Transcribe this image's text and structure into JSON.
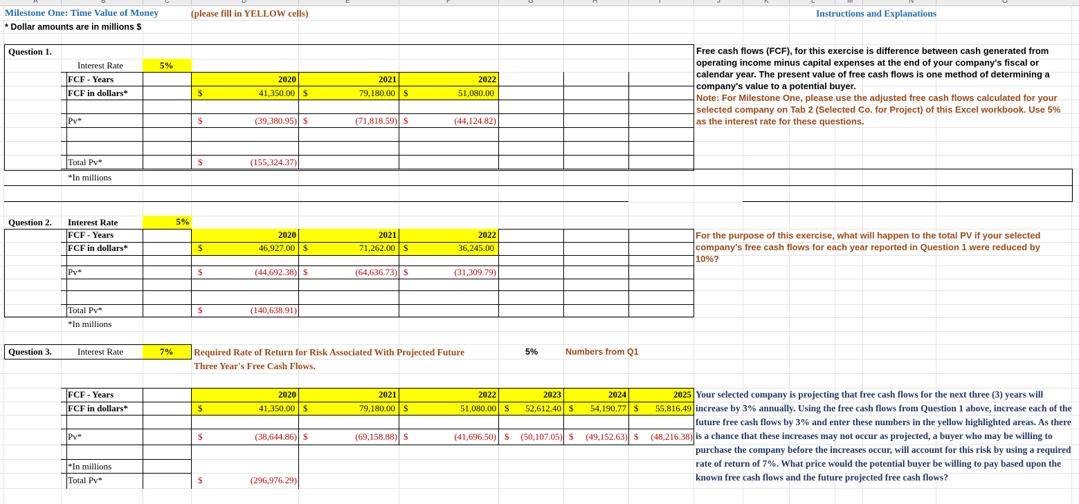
{
  "columns": [
    "A",
    "B",
    "C",
    "D",
    "E",
    "F",
    "G",
    "H",
    "I",
    "J",
    "K",
    "L",
    "M",
    "N",
    "O"
  ],
  "header": {
    "title": "Milestone One: Time Value of Money",
    "fill_note": "(please fill in YELLOW cells)",
    "dollar_note": "* Dollar amounts are in millions $",
    "instructions_title": "Instructions and Explanations"
  },
  "q1": {
    "label": "Question 1.",
    "interest_rate_label": "Interest Rate",
    "interest_rate": "5%",
    "years_label": "FCF - Years",
    "fcf_label": "FCF in dollars*",
    "years": [
      "2020",
      "2021",
      "2022"
    ],
    "fcf": [
      "41,350.00",
      "79,180.00",
      "51,080.00"
    ],
    "pv_label": "Pv*",
    "pv": [
      "(39,380.95)",
      "(71,818.59)",
      "(44,124.82)"
    ],
    "total_label": "Total Pv*",
    "total": "(155,324.37)",
    "millions": "*In millions",
    "explanation": "Free cash flows (FCF), for this exercise is  difference between cash generated from operating income minus capital expenses at the end of your company's fiscal or calendar year. The present value of free cash flows is one method of determining a company's value to a potential buyer.",
    "note": "Note: For Milestone One, please use the adjusted free cash flows calculated for your selected company on Tab 2 (Selected Co. for Project) of this Excel workbook. Use 5% as the interest rate for these questions."
  },
  "q2": {
    "label": "Question 2.",
    "interest_rate_label": "Interest Rate",
    "interest_rate": "5%",
    "years_label": "FCF - Years",
    "fcf_label": "FCF in dollars*",
    "years": [
      "2020",
      "2021",
      "2022"
    ],
    "fcf": [
      "46,927.00",
      "71,262.00",
      "36,245.00"
    ],
    "pv_label": "Pv*",
    "pv": [
      "(44,692.38)",
      "(64,636.73)",
      "(31,309.79)"
    ],
    "total_label": "Total Pv*",
    "total": "(140,638.91)",
    "millions": "*In millions",
    "explanation": "For the purpose of this exercise, what will happen to the total PV if your selected company's free cash flows for each year reported in Question 1 were reduced by 10%?"
  },
  "q3": {
    "label": "Question 3.",
    "interest_rate_label": "Interest Rate",
    "interest_rate": "7%",
    "required_rate_text": "Required Rate of Return for Risk Associated With Projected Future Three Year's Free Cash Flows.",
    "q1_rate": "5%",
    "numbers_from": "Numbers from Q1",
    "years_label": "FCF - Years",
    "fcf_label": "FCF in dollars*",
    "years": [
      "2020",
      "2021",
      "2022",
      "2023",
      "2024",
      "2025"
    ],
    "fcf": [
      "41,350.00",
      "79,180.00",
      "51,080.00",
      "52,612.40",
      "54,190.77",
      "55,816.49"
    ],
    "pv_label": "Pv*",
    "pv": [
      "(38,644.86)",
      "(69,158.88)",
      "(41,696.50)",
      "(50,107.05)",
      "(49,152.63)",
      "(48,216.38)"
    ],
    "millions": "*In millions",
    "total_label": "Total Pv*",
    "total": "(296,976.29)",
    "explanation": "Your selected company is projecting that free cash flows for the next three (3) years will increase by 3% annually.  Using the free cash flows from Question 1 above, increase each  of the future free cash flows by 3% and enter these numbers in the yellow highlighted areas. As there is a chance that these increases may not occur as projected, a buyer who may be willing to purchase the company before the increases occur, will account for this risk by using a required rate of return of 7%. What price would the potential buyer be willing to pay based upon the known free cash flows and the future projected free cash flows?"
  },
  "currency_symbol": "$"
}
